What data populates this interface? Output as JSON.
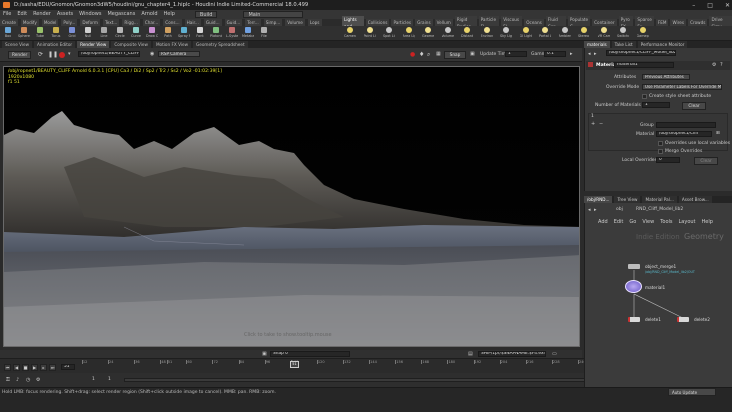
{
  "window": {
    "title": "D:/sasha/EDU/Gnomon/Gnomon3dW5/houdini/gnu_chapter4_1.hiplc - Houdini Indie Limited-Commercial 18.0.499"
  },
  "menu": {
    "items": [
      "File",
      "Edit",
      "Render",
      "Assets",
      "Windows",
      "Megascans",
      "Arnold",
      "Help"
    ],
    "build": "Build",
    "desktop": "Main"
  },
  "shelf": {
    "tabs_left": [
      "Create",
      "Modify",
      "Model",
      "Poly...",
      "Deform",
      "Text...",
      "Rigg...",
      "Char...",
      "Cons...",
      "Hair...",
      "Guid...",
      "Guid...",
      "Terr...",
      "Simp...",
      "Volume",
      "Lops"
    ],
    "tabs_right": [
      "Lights and...",
      "Collisions",
      "Particles",
      "Grains",
      "Vellum",
      "Rigid Bodies",
      "Particle Fl...",
      "Viscous Fl...",
      "Oceans",
      "Fluid Con...",
      "Populate C...",
      "Container",
      "Pyro FX",
      "Sparse Fx",
      "FEM",
      "Wires",
      "Crowds",
      "Drive Simu..."
    ],
    "tools_left": [
      "Box",
      "Sphere",
      "Tube",
      "Torus",
      "Grid",
      "Null",
      "Line",
      "Circle",
      "Curve",
      "Draw Curve",
      "Path",
      "Spray Paint",
      "Font",
      "Platonic Solids",
      "L-System",
      "Metaball",
      "File"
    ],
    "tools_right": [
      "Camera",
      "Point Light",
      "Spot Light",
      "Area Light",
      "Geometry Light",
      "Volume Light",
      "Distant Light",
      "Environment Light",
      "Sky Light",
      "GI Light",
      "Portal Light",
      "Ambient Light",
      "Stereo Camera",
      "VR Camera",
      "Switcher",
      "Gamepad Camera"
    ]
  },
  "pane_tabs": [
    "Scene View",
    "Animation Editor",
    "Render View",
    "Composite View",
    "Motion FX View",
    "Geometry Spreadsheet"
  ],
  "render_view": {
    "render_button": "Render",
    "path": "/obj/ropnet1/BEAUTY_CLIFF",
    "camera": "RSP Camera",
    "snap": "Snap",
    "update_time_label": "Update Time",
    "update_time_value": "1",
    "gamma_label": "Gamma",
    "gamma_value": "0.1",
    "info_line1": "/obj/ropnet1/BEAUTY_CLIFF   Arnold 6.0.3.1 [CPU]  Ca3 / Di2 / Sp2 / Tr2 / Ss2 / Vo2  -01:02:39[1]",
    "info_line2": "1920x1080",
    "info_line3": "f1  51",
    "watermark": "Click to take to show.tooltip.mouse",
    "snap_footer": "Snap 0",
    "output_path": "SHIP/1pr/$SNAPNAME.$F4.exr"
  },
  "timeline": {
    "current_frame": "51",
    "ticks": [
      "12",
      "24",
      "36",
      "48",
      "51",
      "60",
      "72",
      "84",
      "96",
      "108",
      "120",
      "132",
      "144",
      "156",
      "168",
      "180",
      "192",
      "204",
      "216",
      "228",
      "240"
    ],
    "range_start": "1",
    "range_start2": "1",
    "range_end": "240",
    "range_end2": "240"
  },
  "status": {
    "hint": "Hold LMB: focus rendering. Shift+drag: select render region (Shift+click outside image to cancel). MMB: pan. RMB: zoom.",
    "keys": "0 keys, 0/0 channels",
    "key_all": "Key All Channels",
    "auto_update": "Auto Update"
  },
  "params": {
    "tabs": [
      "materials",
      "Take List",
      "Performance Monitor"
    ],
    "node_type": "Material",
    "node_name": "material1",
    "path": "/obj/shopnet1/CLIFF_Model_lib2",
    "attributes_label": "Attributes",
    "attributes_value": "Previous Attributes",
    "override_label": "Override Mode",
    "override_value": "Use Parameter Labels For Override Menu",
    "style_sheet": "Create style sheet attribute",
    "num_materials_label": "Number of Materials",
    "num_materials_value": "1",
    "clear": "Clear",
    "group_label": "Group",
    "material_label": "Material",
    "material_value": "/obj/shopnet1/Cliff",
    "overrides_local": "Overrides use local variables",
    "merge_overrides": "Merge Overrides",
    "local_overrides_label": "Local Overrides",
    "local_overrides_value": "0",
    "clear2": "Clear"
  },
  "network": {
    "tabs": [
      "/obj/RND...",
      "Tree View",
      "Material Pal...",
      "Asset Brow..."
    ],
    "path_obj": "obj",
    "path_node": "RND_Cliff_Model_lib2",
    "menu": [
      "Add",
      "Edit",
      "Go",
      "View",
      "Tools",
      "Layout",
      "Help"
    ],
    "context_label": "Indie Edition",
    "context_type": "Geometry",
    "nodes": [
      {
        "name": "object_merge1",
        "sub": "/obj/RND_Cliff_Model_lib2/OUT"
      },
      {
        "name": "material1",
        "sub": ""
      },
      {
        "name": "delete1",
        "sub": ""
      },
      {
        "name": "delete2",
        "sub": ""
      }
    ]
  },
  "colors": {
    "accent": "#e8792b",
    "node_selected": "#8e7fd8",
    "info_text": "#e0e030",
    "path_cyan": "#59b7c9"
  }
}
